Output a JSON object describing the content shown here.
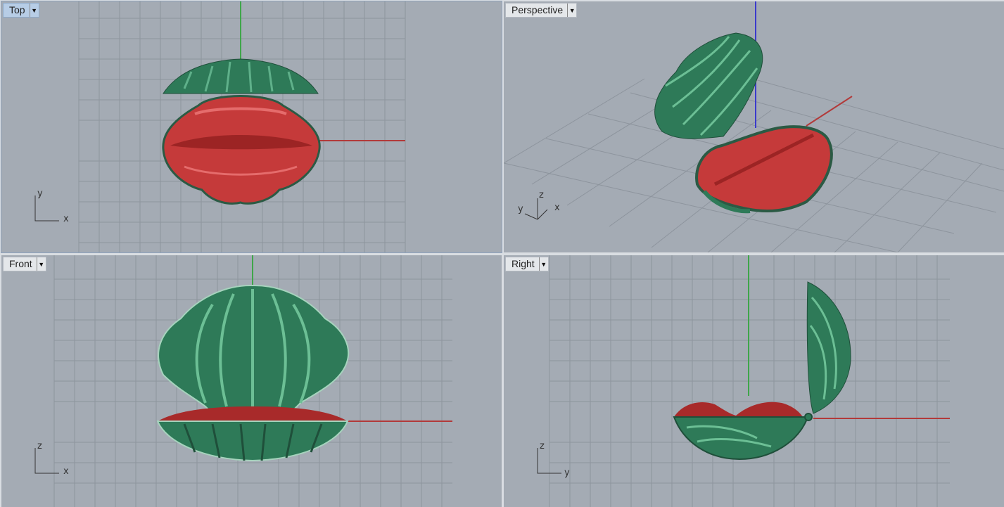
{
  "viewports": {
    "top": {
      "label": "Top",
      "axis_h": "x",
      "axis_v": "y"
    },
    "perspective": {
      "label": "Perspective",
      "axis_a": "y",
      "axis_b": "z",
      "axis_c": "x"
    },
    "front": {
      "label": "Front",
      "axis_h": "x",
      "axis_v": "z"
    },
    "right": {
      "label": "Right",
      "axis_h": "y",
      "axis_v": "z"
    }
  },
  "icons": {
    "viewport_menu": "chevron-down-icon"
  },
  "colors": {
    "viewport_bg": "#a4abb4",
    "grid": "#8b929b",
    "x_axis": "#b23a3a",
    "y_axis": "#3fa64a",
    "z_axis": "#3a3acc",
    "shell_green": "#2e7a58",
    "shell_red": "#c53a3a",
    "active_label": "#b7cde6"
  }
}
